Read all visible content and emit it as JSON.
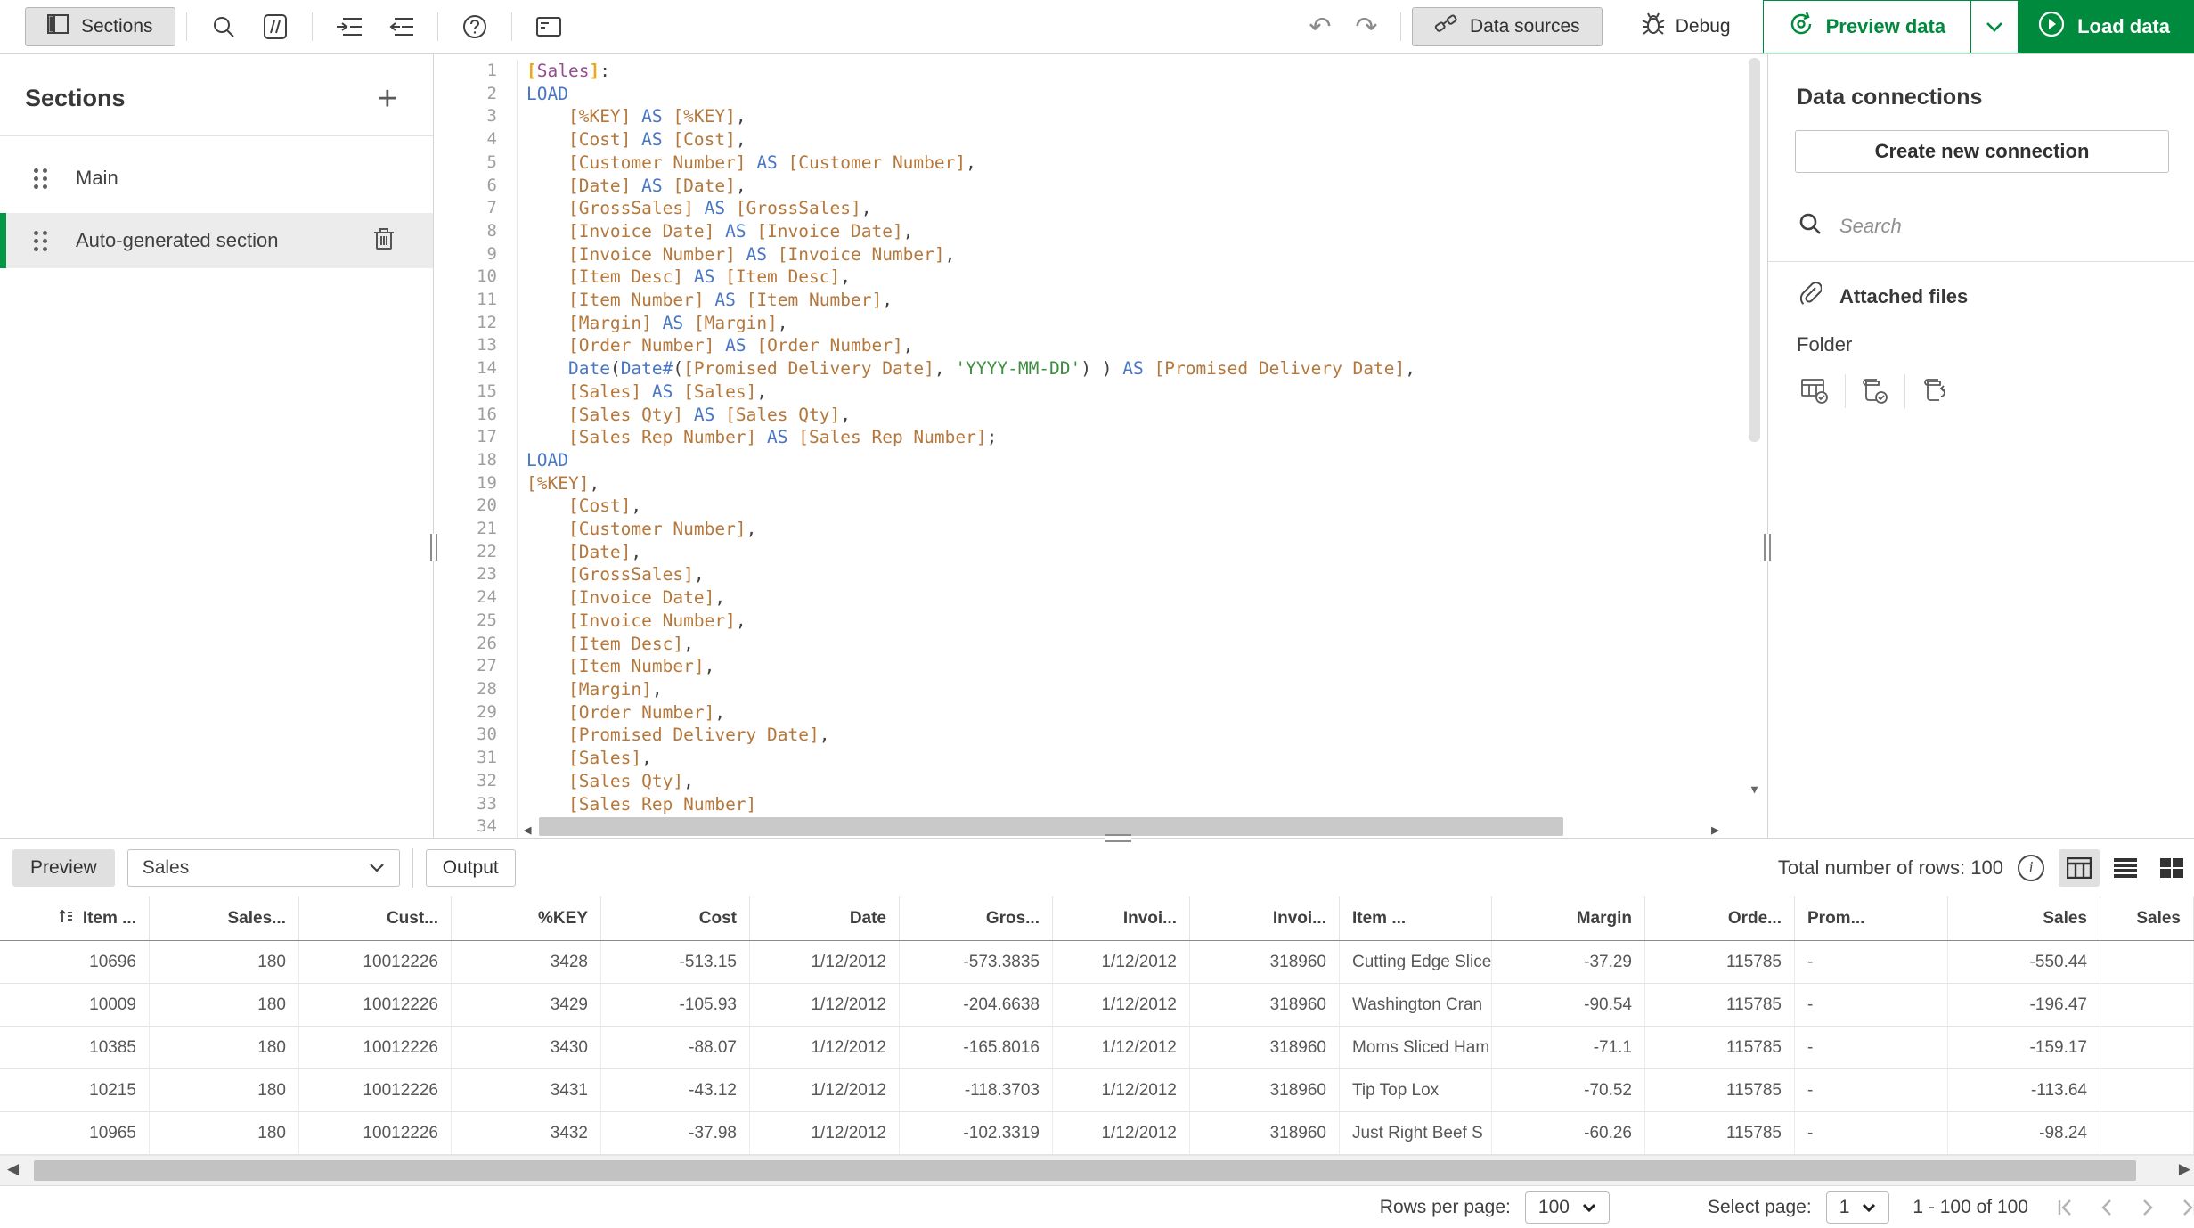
{
  "colors": {
    "accent_green": "#008a3d",
    "code_keyword": "#4a77c4",
    "code_field": "#b5783c",
    "code_string": "#3e8e41",
    "code_table": "#964f8e",
    "code_bracket": "#e9a91c"
  },
  "icons": {
    "undo": "↶",
    "redo": "↷",
    "left_arrow": "◀",
    "right_arrow": "▶",
    "down_arrow": "▼"
  },
  "toolbar": {
    "sections_label": "Sections",
    "data_sources_label": "Data sources",
    "debug_label": "Debug",
    "preview_data_label": "Preview data",
    "load_data_label": "Load data"
  },
  "sidebar": {
    "title": "Sections",
    "items": [
      {
        "label": "Main",
        "selected": false
      },
      {
        "label": "Auto-generated section",
        "selected": true
      }
    ]
  },
  "editor": {
    "last_line_number": "34",
    "lines": [
      [
        [
          "b",
          "["
        ],
        [
          "t",
          "Sales"
        ],
        [
          "b",
          "]"
        ],
        [
          "p",
          ":"
        ]
      ],
      [
        [
          "k",
          "LOAD"
        ]
      ],
      [
        [
          "p",
          "    "
        ],
        [
          "f",
          "[%KEY]"
        ],
        [
          "p",
          " "
        ],
        [
          "k",
          "AS"
        ],
        [
          "p",
          " "
        ],
        [
          "f",
          "[%KEY]"
        ],
        [
          "p",
          ","
        ]
      ],
      [
        [
          "p",
          "    "
        ],
        [
          "f",
          "[Cost]"
        ],
        [
          "p",
          " "
        ],
        [
          "k",
          "AS"
        ],
        [
          "p",
          " "
        ],
        [
          "f",
          "[Cost]"
        ],
        [
          "p",
          ","
        ]
      ],
      [
        [
          "p",
          "    "
        ],
        [
          "f",
          "[Customer Number]"
        ],
        [
          "p",
          " "
        ],
        [
          "k",
          "AS"
        ],
        [
          "p",
          " "
        ],
        [
          "f",
          "[Customer Number]"
        ],
        [
          "p",
          ","
        ]
      ],
      [
        [
          "p",
          "    "
        ],
        [
          "f",
          "[Date]"
        ],
        [
          "p",
          " "
        ],
        [
          "k",
          "AS"
        ],
        [
          "p",
          " "
        ],
        [
          "f",
          "[Date]"
        ],
        [
          "p",
          ","
        ]
      ],
      [
        [
          "p",
          "    "
        ],
        [
          "f",
          "[GrossSales]"
        ],
        [
          "p",
          " "
        ],
        [
          "k",
          "AS"
        ],
        [
          "p",
          " "
        ],
        [
          "f",
          "[GrossSales]"
        ],
        [
          "p",
          ","
        ]
      ],
      [
        [
          "p",
          "    "
        ],
        [
          "f",
          "[Invoice Date]"
        ],
        [
          "p",
          " "
        ],
        [
          "k",
          "AS"
        ],
        [
          "p",
          " "
        ],
        [
          "f",
          "[Invoice Date]"
        ],
        [
          "p",
          ","
        ]
      ],
      [
        [
          "p",
          "    "
        ],
        [
          "f",
          "[Invoice Number]"
        ],
        [
          "p",
          " "
        ],
        [
          "k",
          "AS"
        ],
        [
          "p",
          " "
        ],
        [
          "f",
          "[Invoice Number]"
        ],
        [
          "p",
          ","
        ]
      ],
      [
        [
          "p",
          "    "
        ],
        [
          "f",
          "[Item Desc]"
        ],
        [
          "p",
          " "
        ],
        [
          "k",
          "AS"
        ],
        [
          "p",
          " "
        ],
        [
          "f",
          "[Item Desc]"
        ],
        [
          "p",
          ","
        ]
      ],
      [
        [
          "p",
          "    "
        ],
        [
          "f",
          "[Item Number]"
        ],
        [
          "p",
          " "
        ],
        [
          "k",
          "AS"
        ],
        [
          "p",
          " "
        ],
        [
          "f",
          "[Item Number]"
        ],
        [
          "p",
          ","
        ]
      ],
      [
        [
          "p",
          "    "
        ],
        [
          "f",
          "[Margin]"
        ],
        [
          "p",
          " "
        ],
        [
          "k",
          "AS"
        ],
        [
          "p",
          " "
        ],
        [
          "f",
          "[Margin]"
        ],
        [
          "p",
          ","
        ]
      ],
      [
        [
          "p",
          "    "
        ],
        [
          "f",
          "[Order Number]"
        ],
        [
          "p",
          " "
        ],
        [
          "k",
          "AS"
        ],
        [
          "p",
          " "
        ],
        [
          "f",
          "[Order Number]"
        ],
        [
          "p",
          ","
        ]
      ],
      [
        [
          "p",
          "    "
        ],
        [
          "k",
          "Date"
        ],
        [
          "p",
          "("
        ],
        [
          "k",
          "Date#"
        ],
        [
          "p",
          "("
        ],
        [
          "f",
          "[Promised Delivery Date]"
        ],
        [
          "p",
          ", "
        ],
        [
          "s",
          "'YYYY-MM-DD'"
        ],
        [
          "p",
          ") ) "
        ],
        [
          "k",
          "AS"
        ],
        [
          "p",
          " "
        ],
        [
          "f",
          "[Promised Delivery Date]"
        ],
        [
          "p",
          ","
        ]
      ],
      [
        [
          "p",
          "    "
        ],
        [
          "f",
          "[Sales]"
        ],
        [
          "p",
          " "
        ],
        [
          "k",
          "AS"
        ],
        [
          "p",
          " "
        ],
        [
          "f",
          "[Sales]"
        ],
        [
          "p",
          ","
        ]
      ],
      [
        [
          "p",
          "    "
        ],
        [
          "f",
          "[Sales Qty]"
        ],
        [
          "p",
          " "
        ],
        [
          "k",
          "AS"
        ],
        [
          "p",
          " "
        ],
        [
          "f",
          "[Sales Qty]"
        ],
        [
          "p",
          ","
        ]
      ],
      [
        [
          "p",
          "    "
        ],
        [
          "f",
          "[Sales Rep Number]"
        ],
        [
          "p",
          " "
        ],
        [
          "k",
          "AS"
        ],
        [
          "p",
          " "
        ],
        [
          "f",
          "[Sales Rep Number]"
        ],
        [
          "p",
          ";"
        ]
      ],
      [
        [
          "k",
          "LOAD"
        ]
      ],
      [
        [
          "f",
          "[%KEY]"
        ],
        [
          "p",
          ","
        ]
      ],
      [
        [
          "p",
          "    "
        ],
        [
          "f",
          "[Cost]"
        ],
        [
          "p",
          ","
        ]
      ],
      [
        [
          "p",
          "    "
        ],
        [
          "f",
          "[Customer Number]"
        ],
        [
          "p",
          ","
        ]
      ],
      [
        [
          "p",
          "    "
        ],
        [
          "f",
          "[Date]"
        ],
        [
          "p",
          ","
        ]
      ],
      [
        [
          "p",
          "    "
        ],
        [
          "f",
          "[GrossSales]"
        ],
        [
          "p",
          ","
        ]
      ],
      [
        [
          "p",
          "    "
        ],
        [
          "f",
          "[Invoice Date]"
        ],
        [
          "p",
          ","
        ]
      ],
      [
        [
          "p",
          "    "
        ],
        [
          "f",
          "[Invoice Number]"
        ],
        [
          "p",
          ","
        ]
      ],
      [
        [
          "p",
          "    "
        ],
        [
          "f",
          "[Item Desc]"
        ],
        [
          "p",
          ","
        ]
      ],
      [
        [
          "p",
          "    "
        ],
        [
          "f",
          "[Item Number]"
        ],
        [
          "p",
          ","
        ]
      ],
      [
        [
          "p",
          "    "
        ],
        [
          "f",
          "[Margin]"
        ],
        [
          "p",
          ","
        ]
      ],
      [
        [
          "p",
          "    "
        ],
        [
          "f",
          "[Order Number]"
        ],
        [
          "p",
          ","
        ]
      ],
      [
        [
          "p",
          "    "
        ],
        [
          "f",
          "[Promised Delivery Date]"
        ],
        [
          "p",
          ","
        ]
      ],
      [
        [
          "p",
          "    "
        ],
        [
          "f",
          "[Sales]"
        ],
        [
          "p",
          ","
        ]
      ],
      [
        [
          "p",
          "    "
        ],
        [
          "f",
          "[Sales Qty]"
        ],
        [
          "p",
          ","
        ]
      ],
      [
        [
          "p",
          "    "
        ],
        [
          "f",
          "[Sales Rep Number]"
        ]
      ]
    ]
  },
  "connections": {
    "title": "Data connections",
    "create_button": "Create new connection",
    "search_placeholder": "Search",
    "attached_files_label": "Attached files",
    "folder_label": "Folder"
  },
  "preview": {
    "preview_button": "Preview",
    "table_select_value": "Sales",
    "output_button": "Output",
    "total_rows_label": "Total number of rows: 100"
  },
  "table": {
    "columns": [
      {
        "label": "Item ...",
        "align": "r"
      },
      {
        "label": "Sales...",
        "align": "r"
      },
      {
        "label": "Cust...",
        "align": "r"
      },
      {
        "label": "%KEY",
        "align": "r"
      },
      {
        "label": "Cost",
        "align": "r"
      },
      {
        "label": "Date",
        "align": "r"
      },
      {
        "label": "Gros...",
        "align": "r"
      },
      {
        "label": "Invoi...",
        "align": "r"
      },
      {
        "label": "Invoi...",
        "align": "r"
      },
      {
        "label": "Item ...",
        "align": "l"
      },
      {
        "label": "Margin",
        "align": "r"
      },
      {
        "label": "Orde...",
        "align": "r"
      },
      {
        "label": "Prom...",
        "align": "l"
      },
      {
        "label": "Sales",
        "align": "r"
      },
      {
        "label": "Sales",
        "align": "r"
      }
    ],
    "rows": [
      [
        "10696",
        "180",
        "10012226",
        "3428",
        "-513.15",
        "1/12/2012",
        "-573.3835",
        "1/12/2012",
        "318960",
        "Cutting Edge Slice",
        "-37.29",
        "115785",
        "-",
        "-550.44",
        ""
      ],
      [
        "10009",
        "180",
        "10012226",
        "3429",
        "-105.93",
        "1/12/2012",
        "-204.6638",
        "1/12/2012",
        "318960",
        "Washington Cran",
        "-90.54",
        "115785",
        "-",
        "-196.47",
        ""
      ],
      [
        "10385",
        "180",
        "10012226",
        "3430",
        "-88.07",
        "1/12/2012",
        "-165.8016",
        "1/12/2012",
        "318960",
        "Moms Sliced Ham",
        "-71.1",
        "115785",
        "-",
        "-159.17",
        ""
      ],
      [
        "10215",
        "180",
        "10012226",
        "3431",
        "-43.12",
        "1/12/2012",
        "-118.3703",
        "1/12/2012",
        "318960",
        "Tip Top Lox",
        "-70.52",
        "115785",
        "-",
        "-113.64",
        ""
      ],
      [
        "10965",
        "180",
        "10012226",
        "3432",
        "-37.98",
        "1/12/2012",
        "-102.3319",
        "1/12/2012",
        "318960",
        "Just Right Beef S",
        "-60.26",
        "115785",
        "-",
        "-98.24",
        ""
      ]
    ]
  },
  "pagination": {
    "rows_per_page_label": "Rows per page:",
    "rows_per_page_value": "100",
    "select_page_label": "Select page:",
    "select_page_value": "1",
    "range_label": "1 - 100 of 100"
  }
}
